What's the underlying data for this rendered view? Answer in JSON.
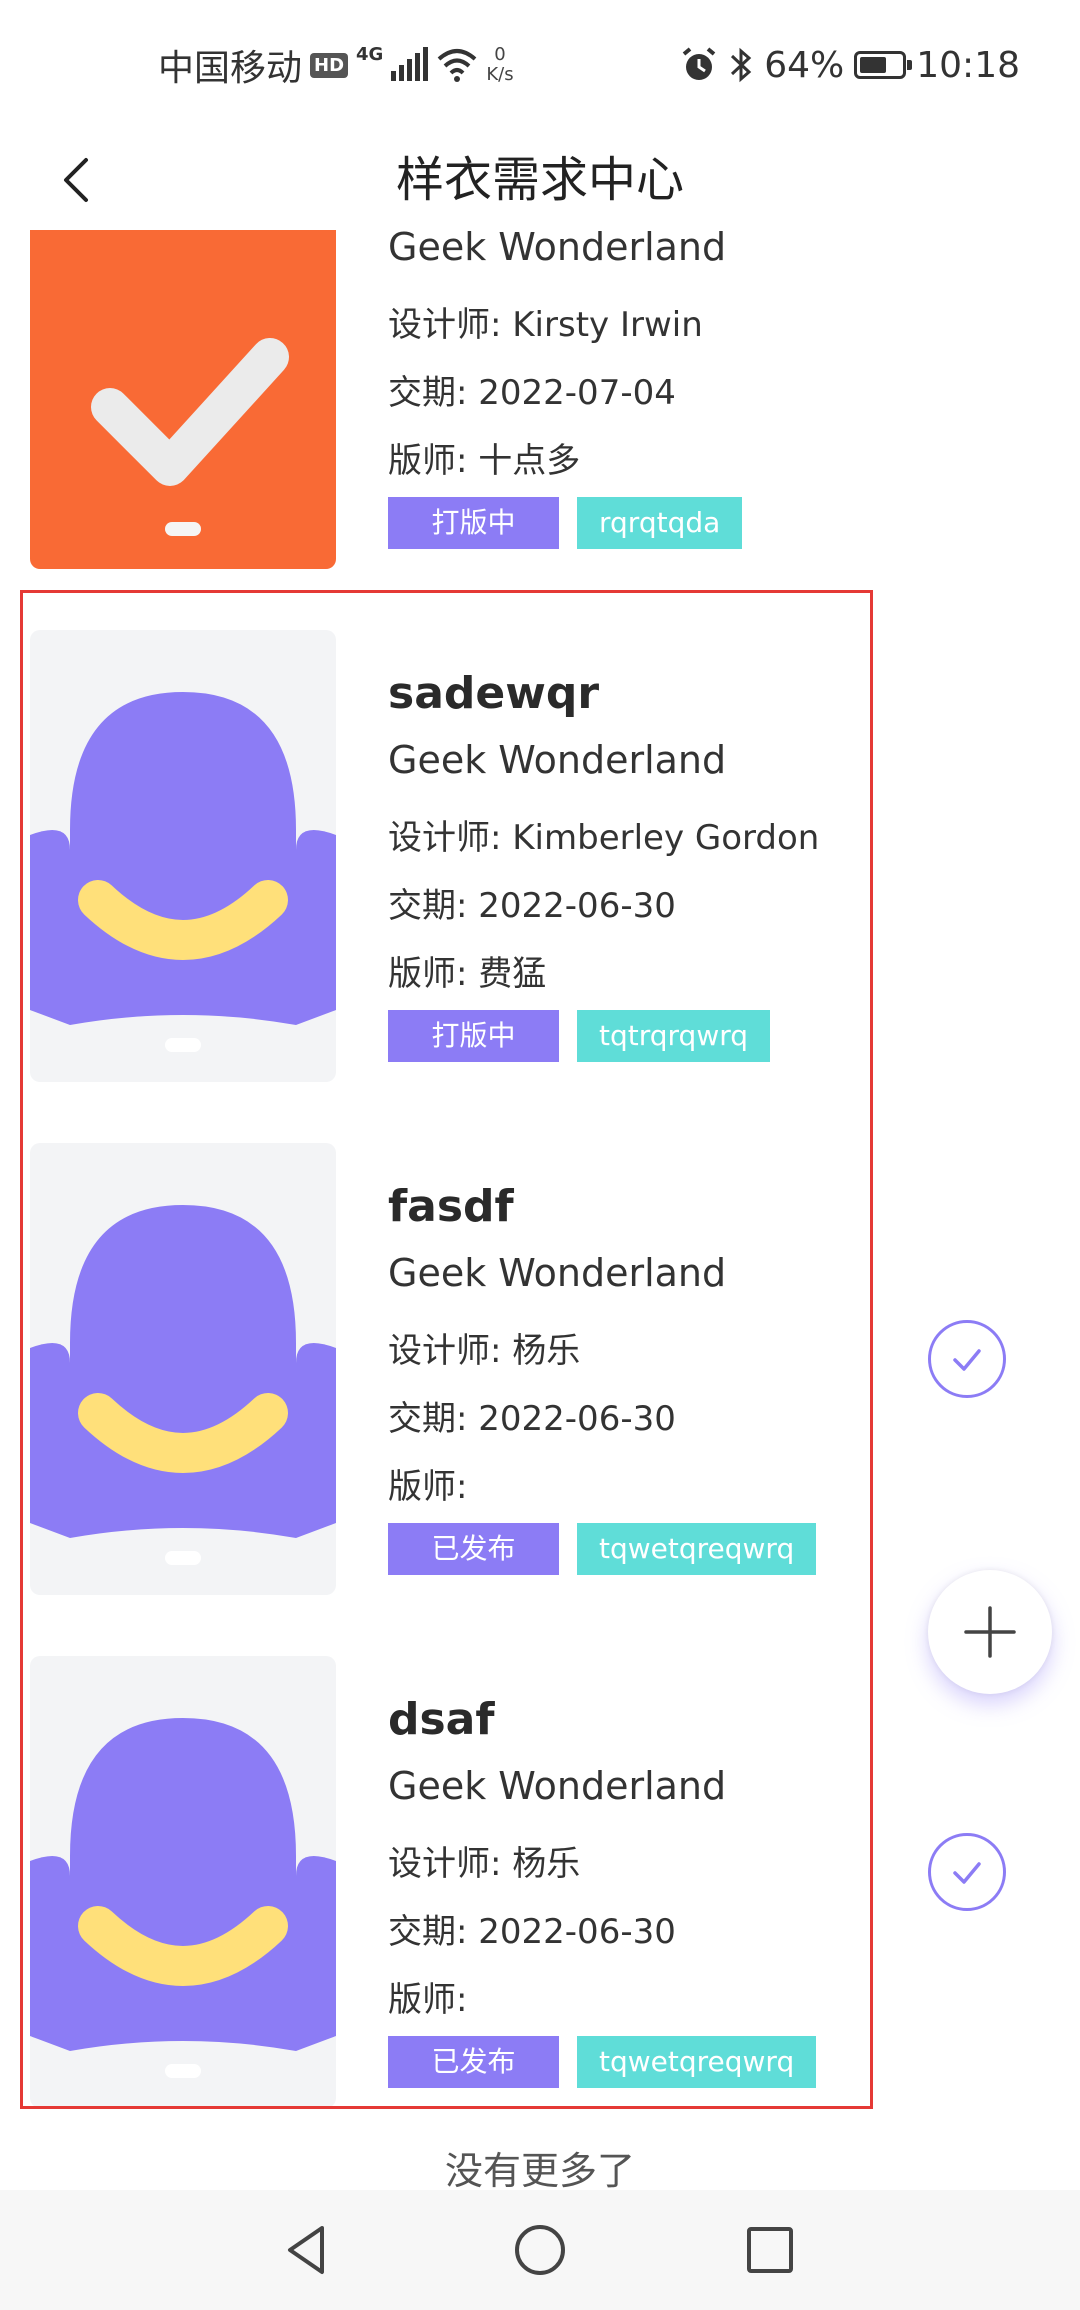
{
  "status_bar": {
    "carrier": "中国移动",
    "hd": "HD",
    "network": "4G",
    "speed_value": "0",
    "speed_unit": "K/s",
    "battery": "64%",
    "battery_level": 0.64,
    "time": "10:18"
  },
  "header": {
    "title": "样衣需求中心"
  },
  "items": [
    {
      "name": "",
      "company": "Geek Wonderland",
      "designer": "设计师: Kirsty Irwin",
      "delivery": "交期: 2022-07-04",
      "pattern_maker": "版师: 十点多",
      "status": "打版中",
      "code": "rqrqtqda",
      "thumb": "orange-check-icon"
    },
    {
      "name": "sadewqr",
      "company": "Geek Wonderland",
      "designer": "设计师: Kimberley Gordon",
      "delivery": "交期: 2022-06-30",
      "pattern_maker": "版师: 费猛",
      "status": "打版中",
      "code": "tqtrqrqwrq",
      "thumb": "purple-placeholder-icon"
    },
    {
      "name": "fasdf",
      "company": "Geek Wonderland",
      "designer": "设计师: 杨乐",
      "delivery": "交期: 2022-06-30",
      "pattern_maker": "版师:",
      "status": "已发布",
      "code": "tqwetqreqwrq",
      "thumb": "purple-placeholder-icon"
    },
    {
      "name": "dsaf",
      "company": "Geek Wonderland",
      "designer": "设计师: 杨乐",
      "delivery": "交期: 2022-06-30",
      "pattern_maker": "版师:",
      "status": "已发布",
      "code": "tqwetqreqwrq",
      "thumb": "purple-placeholder-icon"
    }
  ],
  "footer": {
    "no_more": "没有更多了"
  },
  "colors": {
    "accent": "#8c7cf5",
    "code_tag": "#5fddd8",
    "placeholder_bg": "#f3f4f6",
    "smile": "#ffe07a",
    "orange": "#f96a35",
    "highlight": "#e53935"
  },
  "icons": {
    "back": "chevron-left-icon",
    "check": "check-circle-icon",
    "add": "plus-icon",
    "sys_back": "triangle-back-icon",
    "sys_home": "circle-home-icon",
    "sys_recent": "square-recent-icon"
  }
}
